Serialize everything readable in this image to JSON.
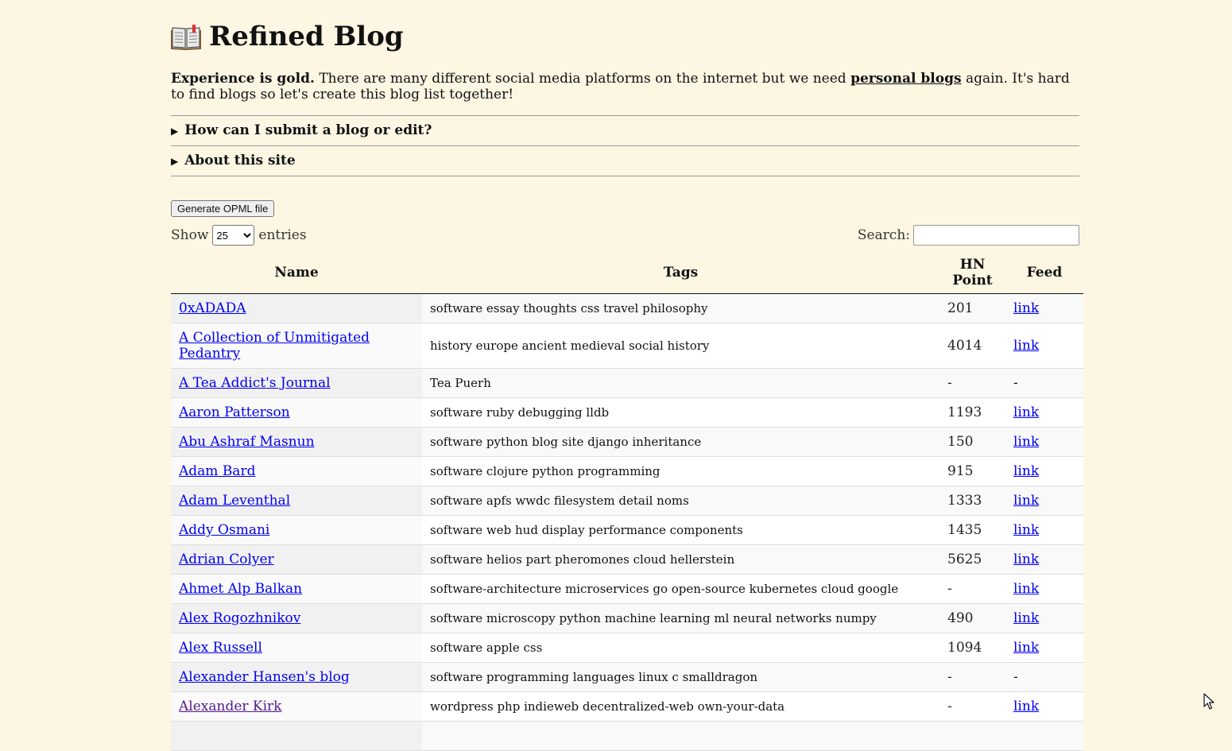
{
  "header": {
    "title": "Refined Blog"
  },
  "intro": {
    "lead": "Experience is gold.",
    "before_link": " There are many different social media platforms on the internet but we need ",
    "link_text": "personal blogs",
    "after_link": " again. It's hard to find blogs so let's create this blog list together!"
  },
  "sections": {
    "submit": "How can I submit a blog or edit?",
    "about": "About this site"
  },
  "toolbar": {
    "opml_button": "Generate OPML file",
    "show_label": "Show",
    "entries_label": "entries",
    "page_size": "25",
    "search_label": "Search:",
    "search_value": ""
  },
  "table": {
    "headers": {
      "name": "Name",
      "tags": "Tags",
      "hn_line1": "HN",
      "hn_line2": "Point",
      "feed": "Feed"
    },
    "rows": [
      {
        "name": "0xADADA",
        "tags": "software essay thoughts css travel philosophy",
        "hn": "201",
        "feed": "link"
      },
      {
        "name": "A Collection of Unmitigated Pedantry",
        "tags": "history europe ancient medieval social history",
        "hn": "4014",
        "feed": "link"
      },
      {
        "name": "A Tea Addict's Journal",
        "tags": "Tea Puerh",
        "hn": "-",
        "feed": "-"
      },
      {
        "name": "Aaron Patterson",
        "tags": "software ruby debugging lldb",
        "hn": "1193",
        "feed": "link"
      },
      {
        "name": "Abu Ashraf Masnun",
        "tags": "software python blog site django inheritance",
        "hn": "150",
        "feed": "link"
      },
      {
        "name": "Adam Bard",
        "tags": "software clojure python programming",
        "hn": "915",
        "feed": "link"
      },
      {
        "name": "Adam Leventhal",
        "tags": "software apfs wwdc filesystem detail noms",
        "hn": "1333",
        "feed": "link"
      },
      {
        "name": "Addy Osmani",
        "tags": "software web hud display performance components",
        "hn": "1435",
        "feed": "link"
      },
      {
        "name": "Adrian Colyer",
        "tags": "software helios part pheromones cloud hellerstein",
        "hn": "5625",
        "feed": "link"
      },
      {
        "name": "Ahmet Alp Balkan",
        "tags": "software-architecture microservices go open-source kubernetes cloud google",
        "hn": "-",
        "feed": "link"
      },
      {
        "name": "Alex Rogozhnikov",
        "tags": "software microscopy python machine learning ml neural networks numpy",
        "hn": "490",
        "feed": "link"
      },
      {
        "name": "Alex Russell",
        "tags": "software apple css",
        "hn": "1094",
        "feed": "link"
      },
      {
        "name": "Alexander Hansen's blog",
        "tags": "software programming languages linux c smalldragon",
        "hn": "-",
        "feed": "-"
      },
      {
        "name": "Alexander Kirk",
        "tags": "wordpress php indieweb decentralized-web own-your-data",
        "hn": "-",
        "feed": "link"
      },
      {
        "name": "",
        "tags": "",
        "hn": "",
        "feed": ""
      }
    ]
  }
}
